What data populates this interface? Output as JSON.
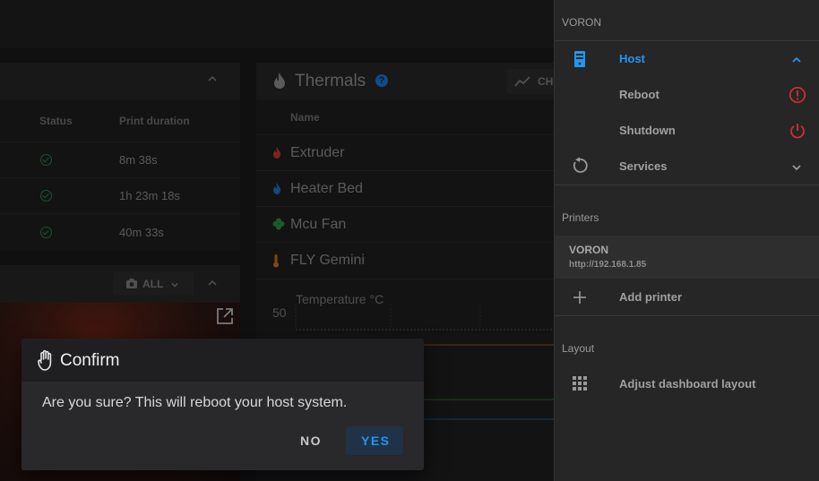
{
  "jobs": {
    "headers": [
      "Status",
      "Print duration"
    ],
    "rows": [
      {
        "duration": "8m 38s"
      },
      {
        "duration": "1h 23m 18s"
      },
      {
        "duration": "40m 33s"
      }
    ]
  },
  "webcam": {
    "filter_label": "ALL"
  },
  "thermals": {
    "title": "Thermals",
    "chart_button": "CH",
    "column_name": "Name",
    "sensors": [
      "Extruder",
      "Heater Bed",
      "Mcu Fan",
      "FLY Gemini"
    ],
    "chart_ylabel": "Temperature °C",
    "chart_tick": "50"
  },
  "drawer": {
    "section_voron": "VORON",
    "host_label": "Host",
    "reboot_label": "Reboot",
    "shutdown_label": "Shutdown",
    "services_label": "Services",
    "section_printers": "Printers",
    "printer_name": "VORON",
    "printer_url": "http://192.168.1.85",
    "add_printer_label": "Add printer",
    "section_layout": "Layout",
    "adjust_layout_label": "Adjust dashboard layout"
  },
  "dialog": {
    "title": "Confirm",
    "message": "Are you sure? This will reboot your host system.",
    "no_label": "NO",
    "yes_label": "YES"
  },
  "colors": {
    "accent_blue": "#2196f3",
    "danger_red": "#d32f2f",
    "success_green": "#2e7d45"
  }
}
